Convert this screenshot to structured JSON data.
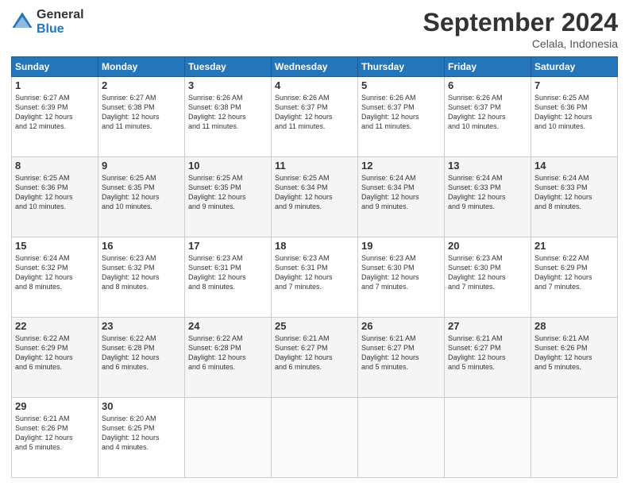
{
  "logo": {
    "general": "General",
    "blue": "Blue"
  },
  "header": {
    "title": "September 2024",
    "location": "Celala, Indonesia"
  },
  "days_of_week": [
    "Sunday",
    "Monday",
    "Tuesday",
    "Wednesday",
    "Thursday",
    "Friday",
    "Saturday"
  ],
  "weeks": [
    [
      {
        "day": "1",
        "sunrise": "6:27 AM",
        "sunset": "6:39 PM",
        "daylight": "12 hours and 12 minutes."
      },
      {
        "day": "2",
        "sunrise": "6:27 AM",
        "sunset": "6:38 PM",
        "daylight": "12 hours and 11 minutes."
      },
      {
        "day": "3",
        "sunrise": "6:26 AM",
        "sunset": "6:38 PM",
        "daylight": "12 hours and 11 minutes."
      },
      {
        "day": "4",
        "sunrise": "6:26 AM",
        "sunset": "6:37 PM",
        "daylight": "12 hours and 11 minutes."
      },
      {
        "day": "5",
        "sunrise": "6:26 AM",
        "sunset": "6:37 PM",
        "daylight": "12 hours and 11 minutes."
      },
      {
        "day": "6",
        "sunrise": "6:26 AM",
        "sunset": "6:37 PM",
        "daylight": "12 hours and 10 minutes."
      },
      {
        "day": "7",
        "sunrise": "6:25 AM",
        "sunset": "6:36 PM",
        "daylight": "12 hours and 10 minutes."
      }
    ],
    [
      {
        "day": "8",
        "sunrise": "6:25 AM",
        "sunset": "6:36 PM",
        "daylight": "12 hours and 10 minutes."
      },
      {
        "day": "9",
        "sunrise": "6:25 AM",
        "sunset": "6:35 PM",
        "daylight": "12 hours and 10 minutes."
      },
      {
        "day": "10",
        "sunrise": "6:25 AM",
        "sunset": "6:35 PM",
        "daylight": "12 hours and 9 minutes."
      },
      {
        "day": "11",
        "sunrise": "6:25 AM",
        "sunset": "6:34 PM",
        "daylight": "12 hours and 9 minutes."
      },
      {
        "day": "12",
        "sunrise": "6:24 AM",
        "sunset": "6:34 PM",
        "daylight": "12 hours and 9 minutes."
      },
      {
        "day": "13",
        "sunrise": "6:24 AM",
        "sunset": "6:33 PM",
        "daylight": "12 hours and 9 minutes."
      },
      {
        "day": "14",
        "sunrise": "6:24 AM",
        "sunset": "6:33 PM",
        "daylight": "12 hours and 8 minutes."
      }
    ],
    [
      {
        "day": "15",
        "sunrise": "6:24 AM",
        "sunset": "6:32 PM",
        "daylight": "12 hours and 8 minutes."
      },
      {
        "day": "16",
        "sunrise": "6:23 AM",
        "sunset": "6:32 PM",
        "daylight": "12 hours and 8 minutes."
      },
      {
        "day": "17",
        "sunrise": "6:23 AM",
        "sunset": "6:31 PM",
        "daylight": "12 hours and 8 minutes."
      },
      {
        "day": "18",
        "sunrise": "6:23 AM",
        "sunset": "6:31 PM",
        "daylight": "12 hours and 7 minutes."
      },
      {
        "day": "19",
        "sunrise": "6:23 AM",
        "sunset": "6:30 PM",
        "daylight": "12 hours and 7 minutes."
      },
      {
        "day": "20",
        "sunrise": "6:23 AM",
        "sunset": "6:30 PM",
        "daylight": "12 hours and 7 minutes."
      },
      {
        "day": "21",
        "sunrise": "6:22 AM",
        "sunset": "6:29 PM",
        "daylight": "12 hours and 7 minutes."
      }
    ],
    [
      {
        "day": "22",
        "sunrise": "6:22 AM",
        "sunset": "6:29 PM",
        "daylight": "12 hours and 6 minutes."
      },
      {
        "day": "23",
        "sunrise": "6:22 AM",
        "sunset": "6:28 PM",
        "daylight": "12 hours and 6 minutes."
      },
      {
        "day": "24",
        "sunrise": "6:22 AM",
        "sunset": "6:28 PM",
        "daylight": "12 hours and 6 minutes."
      },
      {
        "day": "25",
        "sunrise": "6:21 AM",
        "sunset": "6:27 PM",
        "daylight": "12 hours and 6 minutes."
      },
      {
        "day": "26",
        "sunrise": "6:21 AM",
        "sunset": "6:27 PM",
        "daylight": "12 hours and 5 minutes."
      },
      {
        "day": "27",
        "sunrise": "6:21 AM",
        "sunset": "6:27 PM",
        "daylight": "12 hours and 5 minutes."
      },
      {
        "day": "28",
        "sunrise": "6:21 AM",
        "sunset": "6:26 PM",
        "daylight": "12 hours and 5 minutes."
      }
    ],
    [
      {
        "day": "29",
        "sunrise": "6:21 AM",
        "sunset": "6:26 PM",
        "daylight": "12 hours and 5 minutes."
      },
      {
        "day": "30",
        "sunrise": "6:20 AM",
        "sunset": "6:25 PM",
        "daylight": "12 hours and 4 minutes."
      },
      null,
      null,
      null,
      null,
      null
    ]
  ]
}
